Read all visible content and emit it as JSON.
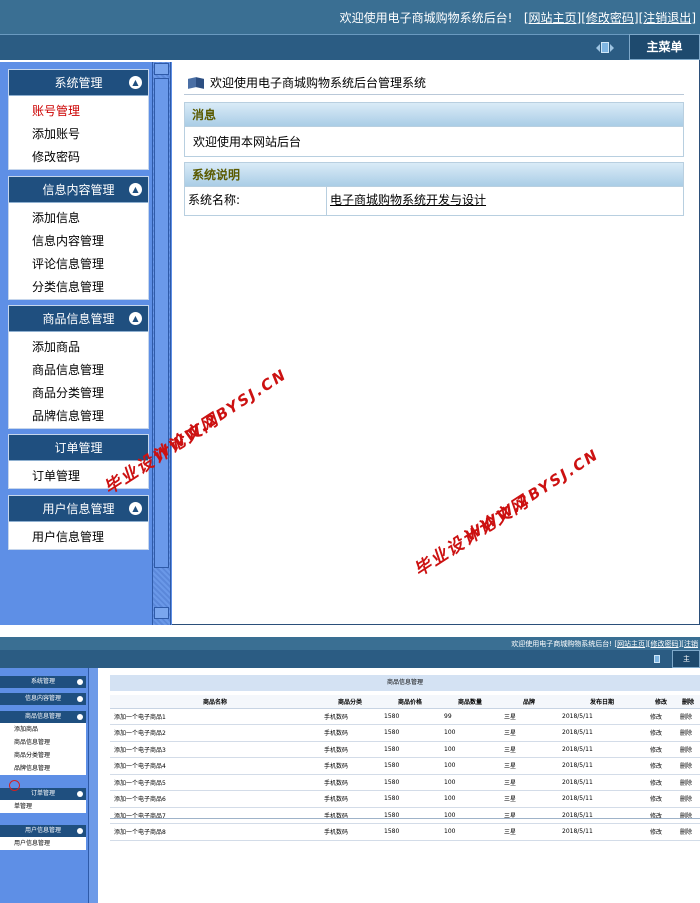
{
  "top": {
    "header": {
      "welcome": "欢迎使用电子商城购物系统后台!",
      "links": [
        "网站主页",
        "修改密码",
        "注销退出"
      ]
    },
    "main_tab": "主菜单",
    "sidebar": {
      "groups": [
        {
          "title": "系统管理",
          "items": [
            "账号管理",
            "添加账号",
            "修改密码"
          ],
          "active": "账号管理"
        },
        {
          "title": "信息内容管理",
          "items": [
            "添加信息",
            "信息内容管理",
            "评论信息管理",
            "分类信息管理"
          ]
        },
        {
          "title": "商品信息管理",
          "items": [
            "添加商品",
            "商品信息管理",
            "商品分类管理",
            "品牌信息管理"
          ]
        },
        {
          "title": "订单管理",
          "items": [
            "订单管理"
          ]
        },
        {
          "title": "用户信息管理",
          "items": [
            "用户信息管理"
          ]
        }
      ]
    },
    "main": {
      "title": "欢迎使用电子商城购物系统后台管理系统",
      "message_panel": {
        "title": "消息",
        "body": "欢迎使用本网站后台"
      },
      "info_panel": {
        "title": "系统说明",
        "key": "系统名称:",
        "value": "电子商城购物系统开发与设计"
      }
    },
    "watermark": {
      "cn": "毕业设计论文网",
      "url": "WWW.2BYSJ.CN"
    }
  },
  "bottom": {
    "header": {
      "welcome": "欢迎使用电子商城购物系统后台!",
      "links": [
        "网站主页",
        "修改密码",
        "注销"
      ]
    },
    "main_tab": "主",
    "sidebar": {
      "groups": [
        {
          "title": "系统管理",
          "items": []
        },
        {
          "title": "信息内容管理",
          "items": []
        },
        {
          "title": "商品信息管理",
          "items": [
            "添加商品",
            "商品信息管理",
            "商品分类管理",
            "品牌信息管理"
          ]
        },
        {
          "title": "订单管理",
          "items": [
            "单管理"
          ]
        },
        {
          "title": "用户信息管理",
          "items": [
            "用户信息管理"
          ]
        }
      ]
    },
    "table": {
      "caption": "商品信息管理",
      "columns": [
        "商品名称",
        "商品分类",
        "商品价格",
        "商品数量",
        "品牌",
        "发布日期",
        "修改",
        "删除"
      ],
      "rows": [
        [
          "添加一个电子商品1",
          "手机数码",
          "1580",
          "99",
          "三星",
          "2018/5/11",
          "修改",
          "删除"
        ],
        [
          "添加一个电子商品2",
          "手机数码",
          "1580",
          "100",
          "三星",
          "2018/5/11",
          "修改",
          "删除"
        ],
        [
          "添加一个电子商品3",
          "手机数码",
          "1580",
          "100",
          "三星",
          "2018/5/11",
          "修改",
          "删除"
        ],
        [
          "添加一个电子商品4",
          "手机数码",
          "1580",
          "100",
          "三星",
          "2018/5/11",
          "修改",
          "删除"
        ],
        [
          "添加一个电子商品5",
          "手机数码",
          "1580",
          "100",
          "三星",
          "2018/5/11",
          "修改",
          "删除"
        ],
        [
          "添加一个电子商品6",
          "手机数码",
          "1580",
          "100",
          "三星",
          "2018/5/11",
          "修改",
          "删除"
        ],
        [
          "添加一个电子商品7",
          "手机数码",
          "1580",
          "100",
          "三星",
          "2018/5/11",
          "修改",
          "删除"
        ],
        [
          "添加一个电子商品8",
          "手机数码",
          "1580",
          "100",
          "三星",
          "2018/5/11",
          "修改",
          "删除"
        ]
      ]
    }
  },
  "colors": {
    "header": "#3a6f93",
    "sidebar": "#5e8fe6",
    "menu_head": "#1f4f7f",
    "active_item": "#cc0000",
    "watermark": "#cc1111"
  }
}
